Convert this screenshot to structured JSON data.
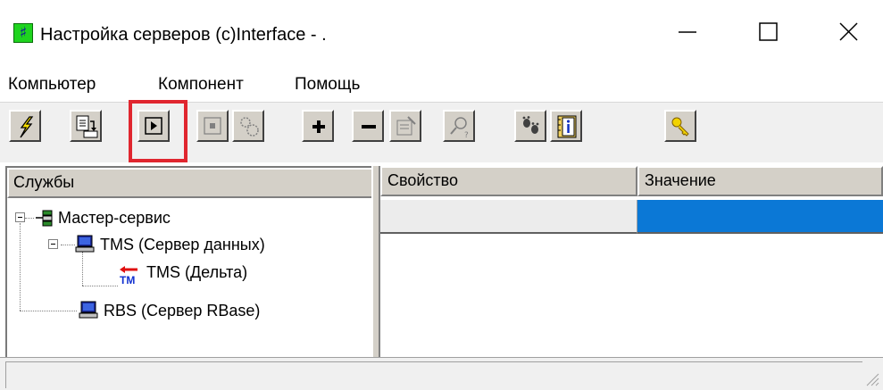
{
  "window": {
    "title": "Настройка серверов (c)Interface - .",
    "icon": "app-logo-icon",
    "icon_glyph": "♯"
  },
  "menu": {
    "items": [
      "Компьютер",
      "Компонент",
      "Помощь"
    ]
  },
  "toolbar": {
    "buttons": [
      {
        "icon": "lightning-icon"
      },
      {
        "icon": "import-icon"
      },
      {
        "icon": "play-icon",
        "highlighted": true
      },
      {
        "icon": "stop-icon",
        "disabled": true
      },
      {
        "icon": "gears-icon",
        "disabled": true
      },
      {
        "icon": "plus-icon"
      },
      {
        "icon": "minus-icon"
      },
      {
        "icon": "properties-icon",
        "disabled": true
      },
      {
        "icon": "search-help-icon",
        "disabled": true
      },
      {
        "icon": "footprints-icon"
      },
      {
        "icon": "info-book-icon"
      },
      {
        "icon": "key-icon"
      }
    ],
    "highlight_color": "#e0262f"
  },
  "left_panel": {
    "header": "Службы",
    "tree": [
      {
        "label": "Мастер-сервис",
        "icon": "network-icon",
        "level": 0
      },
      {
        "label": "TMS (Сервер данных)",
        "icon": "computer-icon",
        "level": 1
      },
      {
        "label": "TMS (Дельта)",
        "icon": "tm-icon",
        "level": 2
      },
      {
        "label": "RBS (Сервер RBase)",
        "icon": "computer-icon",
        "level": 1
      }
    ]
  },
  "right_panel": {
    "columns": [
      "Свойство",
      "Значение"
    ],
    "selected_color": "#0b78d6"
  },
  "colors": {
    "toolbar_bg": "#f0f0f0",
    "button_face": "#d4d0c8",
    "app_icon_green": "#1fd41f"
  }
}
